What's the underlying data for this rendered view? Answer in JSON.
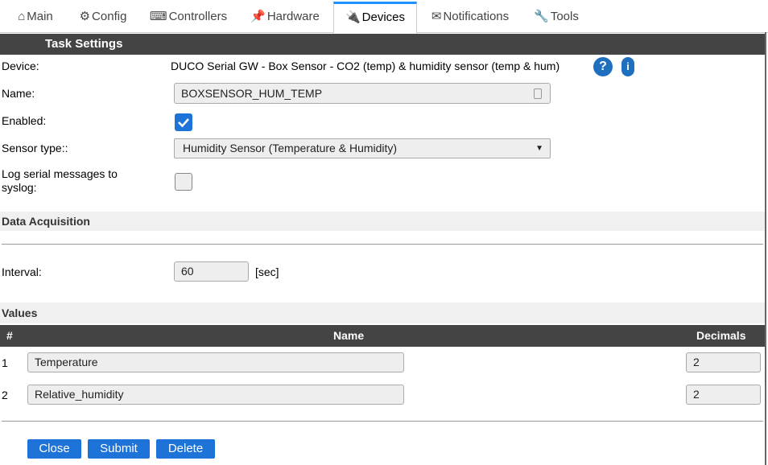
{
  "tabs": [
    {
      "icon": "⌂",
      "label": "Main"
    },
    {
      "icon": "⚙",
      "label": "Config"
    },
    {
      "icon": "⌨",
      "label": "Controllers"
    },
    {
      "icon": "📌",
      "label": "Hardware"
    },
    {
      "icon": "🔌",
      "label": "Devices"
    },
    {
      "icon": "✉",
      "label": "Notifications"
    },
    {
      "icon": "🔧",
      "label": "Tools"
    }
  ],
  "task_settings": {
    "header": "Task Settings",
    "device_label": "Device:",
    "device_value": "DUCO Serial GW - Box Sensor - CO2 (temp) & humidity sensor (temp & hum)",
    "name_label": "Name:",
    "name_value": "BOXSENSOR_HUM_TEMP",
    "enabled_label": "Enabled:",
    "enabled": true,
    "sensor_type_label": "Sensor type::",
    "sensor_type_value": "Humidity Sensor (Temperature & Humidity)",
    "log_label_line1": "Log serial messages to",
    "log_label_line2": "syslog:",
    "log_enabled": false
  },
  "data_acquisition": {
    "header": "Data Acquisition",
    "interval_label": "Interval:",
    "interval_value": "60",
    "interval_unit": "[sec]"
  },
  "values": {
    "header": "Values",
    "col_index": "#",
    "col_name": "Name",
    "col_decimals": "Decimals",
    "rows": [
      {
        "index": "1",
        "name": "Temperature",
        "decimals": "2"
      },
      {
        "index": "2",
        "name": "Relative_humidity",
        "decimals": "2"
      }
    ]
  },
  "buttons": {
    "close": "Close",
    "submit": "Submit",
    "delete": "Delete"
  },
  "colors": {
    "accent": "#1e73d8",
    "header_bg": "#444444",
    "tab_active_top": "#1e90ff"
  }
}
